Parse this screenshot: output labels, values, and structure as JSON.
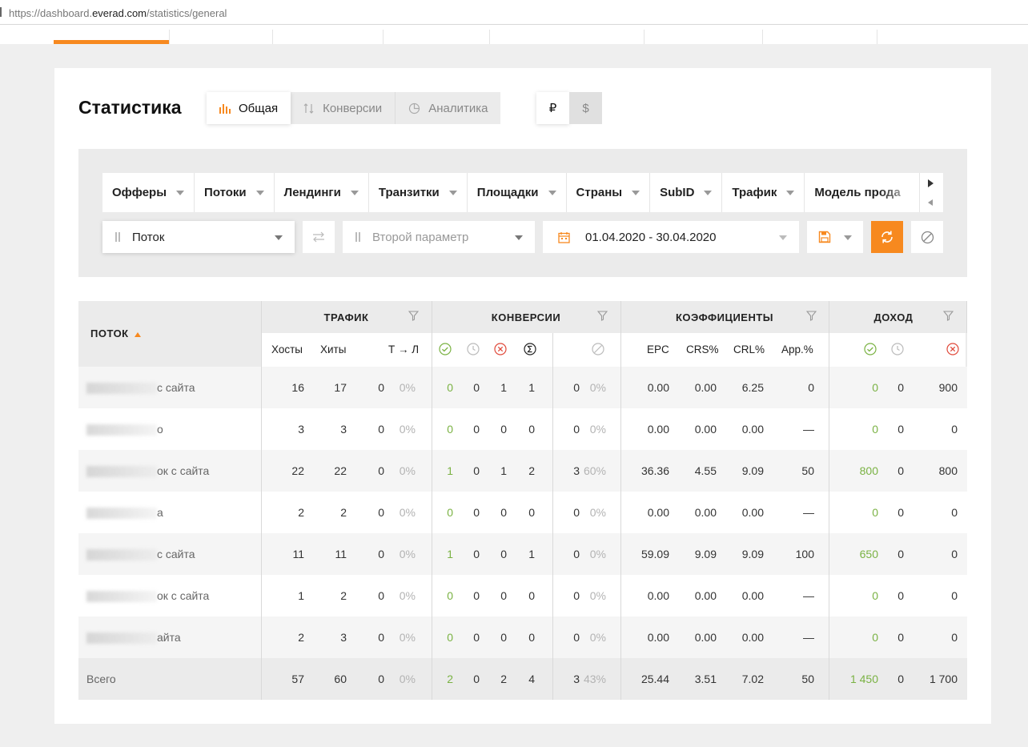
{
  "browser": {
    "url_prefix": "https://dashboard.",
    "url_domain": "everad.com",
    "url_path": "/statistics/general"
  },
  "page": {
    "title": "Статистика"
  },
  "view_tabs": [
    {
      "label": "Общая",
      "icon": "bar-chart-icon",
      "active": true
    },
    {
      "label": "Конверсии",
      "icon": "sort-arrows-icon",
      "active": false
    },
    {
      "label": "Аналитика",
      "icon": "pie-chart-icon",
      "active": false
    }
  ],
  "currency": [
    {
      "label": "₽",
      "active": true
    },
    {
      "label": "$",
      "active": false
    }
  ],
  "filters": [
    "Офферы",
    "Потоки",
    "Лендинги",
    "Транзитки",
    "Площадки",
    "Страны",
    "SubID",
    "Трафик",
    "Модель прода"
  ],
  "controls": {
    "param1_value": "Поток",
    "param2_placeholder": "Второй параметр",
    "date_range": "01.04.2020 - 30.04.2020"
  },
  "colors": {
    "accent": "#f7891f",
    "green": "#7ab243"
  },
  "table": {
    "name_header": "ПОТОК",
    "groups": {
      "traffic": "ТРАФИК",
      "conversions": "КОНВЕРСИИ",
      "coefficients": "КОЭФФИЦИЕНТЫ",
      "income": "ДОХОД"
    },
    "sub_headers": {
      "hosts": "Хосты",
      "hits": "Хиты",
      "tl": "Т → Л",
      "epc": "EPC",
      "crs": "CRS%",
      "crl": "CRL%",
      "app": "App.%"
    },
    "rows": [
      {
        "name": "с сайта",
        "hosts": "16",
        "hits": "17",
        "t": "0",
        "tp": "0%",
        "ok": "0",
        "wait": "0",
        "rej": "1",
        "sum": "1",
        "tr": "0",
        "trp": "0%",
        "epc": "0.00",
        "crs": "0.00",
        "crl": "6.25",
        "app": "0",
        "inc_ok": "0",
        "inc_wait": "0",
        "inc_rej": "900"
      },
      {
        "name": "о",
        "hosts": "3",
        "hits": "3",
        "t": "0",
        "tp": "0%",
        "ok": "0",
        "wait": "0",
        "rej": "0",
        "sum": "0",
        "tr": "0",
        "trp": "0%",
        "epc": "0.00",
        "crs": "0.00",
        "crl": "0.00",
        "app": "—",
        "inc_ok": "0",
        "inc_wait": "0",
        "inc_rej": "0"
      },
      {
        "name": "ок с сайта",
        "hosts": "22",
        "hits": "22",
        "t": "0",
        "tp": "0%",
        "ok": "1",
        "wait": "0",
        "rej": "1",
        "sum": "2",
        "tr": "3",
        "trp": "60%",
        "epc": "36.36",
        "crs": "4.55",
        "crl": "9.09",
        "app": "50",
        "inc_ok": "800",
        "inc_wait": "0",
        "inc_rej": "800"
      },
      {
        "name": "а",
        "hosts": "2",
        "hits": "2",
        "t": "0",
        "tp": "0%",
        "ok": "0",
        "wait": "0",
        "rej": "0",
        "sum": "0",
        "tr": "0",
        "trp": "0%",
        "epc": "0.00",
        "crs": "0.00",
        "crl": "0.00",
        "app": "—",
        "inc_ok": "0",
        "inc_wait": "0",
        "inc_rej": "0"
      },
      {
        "name": "с сайта",
        "hosts": "11",
        "hits": "11",
        "t": "0",
        "tp": "0%",
        "ok": "1",
        "wait": "0",
        "rej": "0",
        "sum": "1",
        "tr": "0",
        "trp": "0%",
        "epc": "59.09",
        "crs": "9.09",
        "crl": "9.09",
        "app": "100",
        "inc_ok": "650",
        "inc_wait": "0",
        "inc_rej": "0"
      },
      {
        "name": "ок с сайта",
        "hosts": "1",
        "hits": "2",
        "t": "0",
        "tp": "0%",
        "ok": "0",
        "wait": "0",
        "rej": "0",
        "sum": "0",
        "tr": "0",
        "trp": "0%",
        "epc": "0.00",
        "crs": "0.00",
        "crl": "0.00",
        "app": "—",
        "inc_ok": "0",
        "inc_wait": "0",
        "inc_rej": "0"
      },
      {
        "name": "айта",
        "hosts": "2",
        "hits": "3",
        "t": "0",
        "tp": "0%",
        "ok": "0",
        "wait": "0",
        "rej": "0",
        "sum": "0",
        "tr": "0",
        "trp": "0%",
        "epc": "0.00",
        "crs": "0.00",
        "crl": "0.00",
        "app": "—",
        "inc_ok": "0",
        "inc_wait": "0",
        "inc_rej": "0"
      }
    ],
    "total": {
      "name": "Всего",
      "hosts": "57",
      "hits": "60",
      "t": "0",
      "tp": "0%",
      "ok": "2",
      "wait": "0",
      "rej": "2",
      "sum": "4",
      "tr": "3",
      "trp": "43%",
      "epc": "25.44",
      "crs": "3.51",
      "crl": "7.02",
      "app": "50",
      "inc_ok": "1 450",
      "inc_wait": "0",
      "inc_rej": "1 700"
    }
  }
}
